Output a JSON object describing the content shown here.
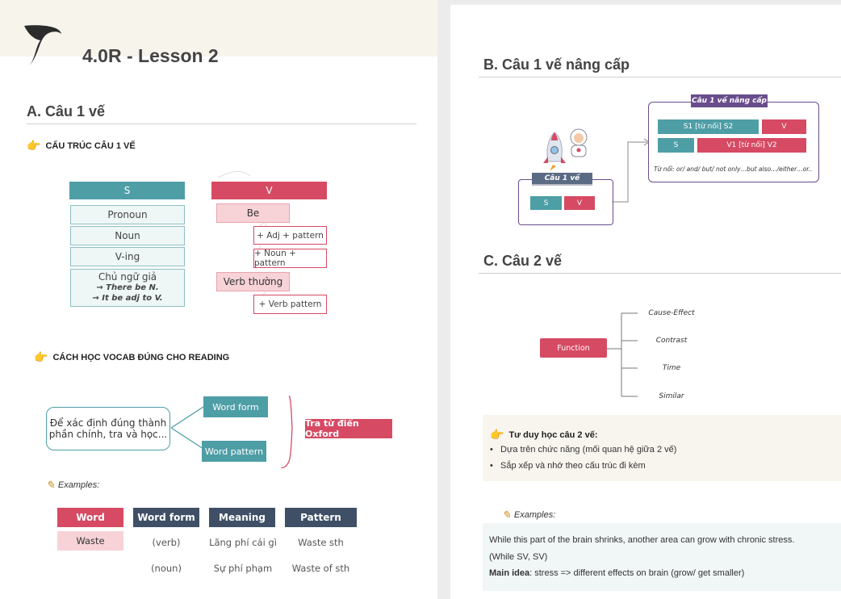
{
  "doc": {
    "title": "4.0R - Lesson 2"
  },
  "sectionA": {
    "title": "A. Câu 1 vế",
    "structure_heading": "CẤU TRÚC CÂU 1 VẾ",
    "s_header": "S",
    "v_header": "V",
    "s_items": [
      "Pronoun",
      "Noun",
      "V-ing"
    ],
    "fake_subject": {
      "line1": "Chủ ngữ giả",
      "line2": "→ There be N.",
      "line3": "→ It be adj to V."
    },
    "be": "Be",
    "be_patterns": [
      "+ Adj + pattern",
      "+ Noun + pattern"
    ],
    "verb_normal": "Verb thường",
    "verb_pattern": "+ Verb pattern",
    "vocab_heading": "CÁCH HỌC VOCAB ĐÚNG CHO READING",
    "vocab_intro": {
      "line1": "Để xác định đúng thành",
      "line2": "phần chính, tra và học..."
    },
    "word_form": "Word form",
    "word_pattern": "Word pattern",
    "dictionary": "Tra từ điển Oxford",
    "examples_label": "Examples:",
    "table_headers": [
      "Word",
      "Word form",
      "Meaning",
      "Pattern"
    ],
    "table_rows": [
      [
        "Waste",
        "(verb)",
        "Lãng phí cái gì",
        "Waste sth"
      ],
      [
        "",
        "(noun)",
        "Sự phí phạm",
        "Waste of sth"
      ]
    ]
  },
  "sectionB": {
    "title": "B. Câu 1 vế nâng cấp",
    "simple_label": "Câu 1 vế",
    "s": "S",
    "v": "V",
    "upgraded_label": "Câu 1 vế nâng cấp",
    "row1": [
      "S1 [từ nối] S2",
      "V"
    ],
    "row2": [
      "S",
      "V1 [từ nối] V2"
    ],
    "connectors": "Từ nối: or/ and/ but/ not only…but also…/either…or.."
  },
  "sectionC": {
    "title": "C. Câu 2 vế",
    "function": "Function",
    "branches": [
      "Cause-Effect",
      "Contrast",
      "Time",
      "Similar"
    ],
    "thinking_title": "Tư duy học câu 2 vế:",
    "bullets": [
      "Dựa trên chức năng (mối quan hệ giữa 2 vế)",
      "Sắp xếp và nhớ theo cấu trúc đi kèm"
    ],
    "examples_label": "Examples:",
    "example_sentence": "While this part of the brain shrinks, another area can grow with chronic stress.",
    "example_structure": "(While SV, SV)",
    "main_idea_label": "Main idea",
    "main_idea_text": ": stress => different effects on brain (grow/ get smaller)"
  },
  "icons": [
    "logo-icon",
    "pointing-hand-icon",
    "pencil-icon",
    "rocket-icon",
    "astronaut-icon"
  ],
  "colors": {
    "teal": "#4e9ea6",
    "red": "#d64a63",
    "navy": "#3f4f66",
    "purple": "#6a4c8c"
  }
}
